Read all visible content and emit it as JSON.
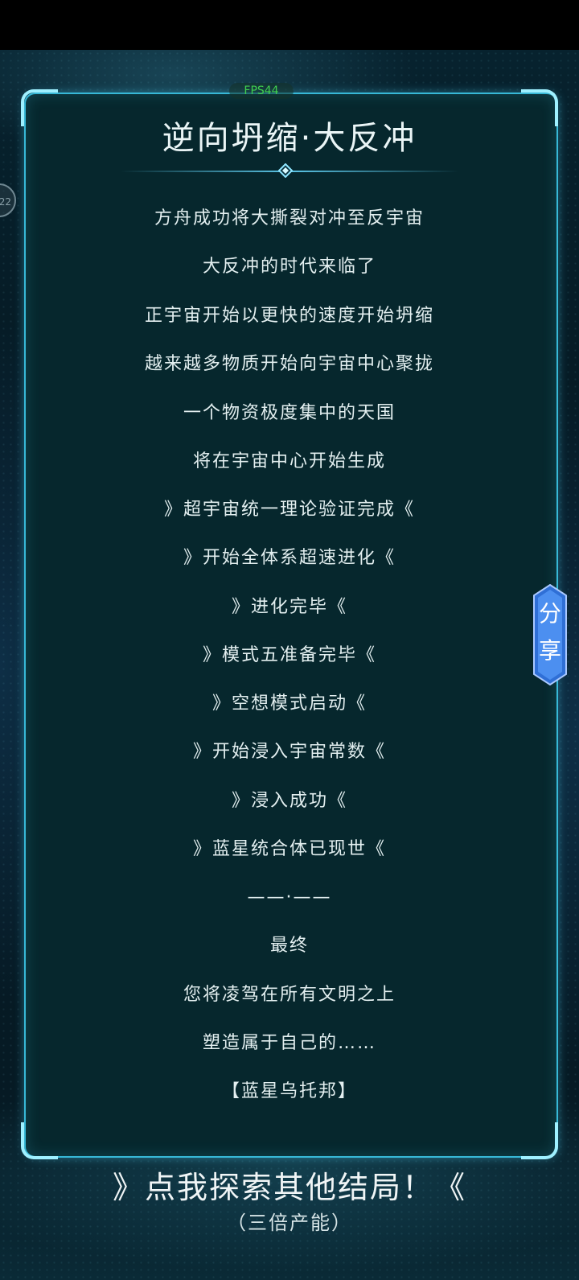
{
  "fps": "FPS44",
  "side_badge": "22",
  "title": "逆向坍缩·大反冲",
  "lines": [
    "方舟成功将大撕裂对冲至反宇宙",
    "大反冲的时代来临了",
    "正宇宙开始以更快的速度开始坍缩",
    "越来越多物质开始向宇宙中心聚拢",
    "一个物资极度集中的天国",
    "将在宇宙中心开始生成",
    "》超宇宙统一理论验证完成《",
    "》开始全体系超速进化《",
    "》进化完毕《",
    "》模式五准备完毕《",
    "》空想模式启动《",
    "》开始浸入宇宙常数《",
    "》浸入成功《",
    "》蓝星统合体已现世《",
    "——·——",
    "最终",
    "您将凌驾在所有文明之上",
    "塑造属于自己的……",
    "【蓝星乌托邦】"
  ],
  "share_button": {
    "char1": "分",
    "char2": "享"
  },
  "explore_button": {
    "label": "》点我探索其他结局！《",
    "sub": "（三倍产能）"
  },
  "colors": {
    "frame": "#37b8d7",
    "panel": "#06272d",
    "fps": "#3fd04f",
    "share": "#5a8fe0"
  }
}
